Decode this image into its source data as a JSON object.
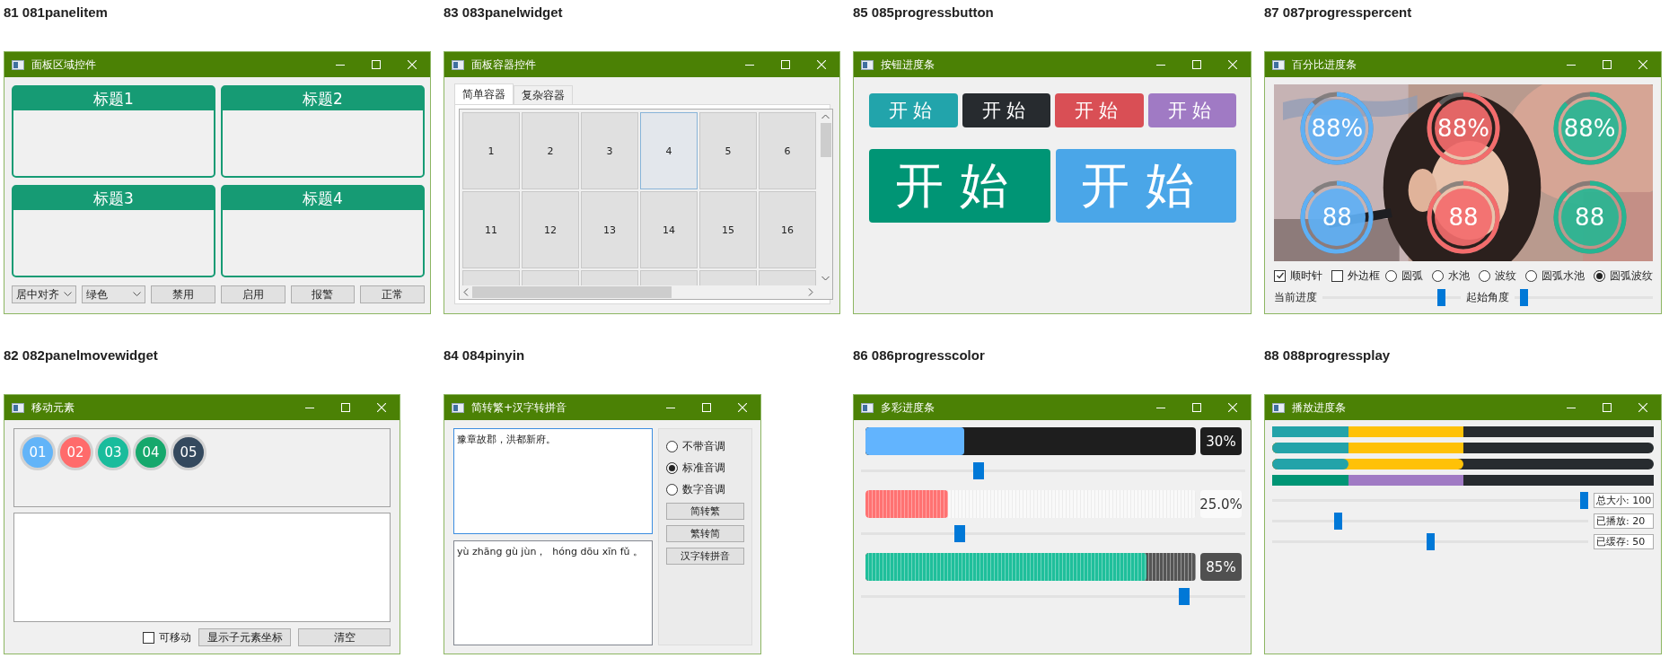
{
  "windows": [
    {
      "kind": "panelitem",
      "caption": "81 081panelitem",
      "title": "面板区域控件",
      "panels": [
        {
          "title": "标题1"
        },
        {
          "title": "标题2"
        },
        {
          "title": "标题3"
        },
        {
          "title": "标题4"
        }
      ],
      "combos": [
        {
          "value": "居中对齐"
        },
        {
          "value": "绿色"
        }
      ],
      "buttons": [
        "禁用",
        "启用",
        "报警",
        "正常"
      ]
    },
    {
      "kind": "panelwidget",
      "caption": "83 083panelwidget",
      "title": "面板容器控件",
      "tabs": [
        {
          "label": "简单容器",
          "selected": true
        },
        {
          "label": "复杂容器",
          "selected": false
        }
      ],
      "cells": [
        {
          "label": "1",
          "selected": false
        },
        {
          "label": "2",
          "selected": false
        },
        {
          "label": "3",
          "selected": false
        },
        {
          "label": "4",
          "selected": true
        },
        {
          "label": "5",
          "selected": false
        },
        {
          "label": "6",
          "selected": false
        },
        {
          "label": "11",
          "selected": false
        },
        {
          "label": "12",
          "selected": false
        },
        {
          "label": "13",
          "selected": false
        },
        {
          "label": "14",
          "selected": false
        },
        {
          "label": "15",
          "selected": false
        },
        {
          "label": "16",
          "selected": false
        }
      ]
    },
    {
      "kind": "progressbutton",
      "caption": "85 085progressbutton",
      "title": "按钮进度条",
      "small_buttons": [
        {
          "label": "开始",
          "color": "#22a4ab"
        },
        {
          "label": "开始",
          "color": "#272b2f"
        },
        {
          "label": "开始",
          "color": "#d94f55"
        },
        {
          "label": "开始",
          "color": "#a07ac4"
        }
      ],
      "large_buttons": [
        {
          "label": "开始",
          "color": "#009575"
        },
        {
          "label": "开始",
          "color": "#4aa6e8"
        }
      ]
    },
    {
      "kind": "progresspercent",
      "caption": "87 087progresspercent",
      "title": "百分比进度条",
      "picture": {
        "kind": "picture"
      },
      "rings": [
        {
          "text": "88%",
          "color": "#5eb0f5",
          "level": 0.88
        },
        {
          "text": "88%",
          "color": "#f36c6c",
          "level": 0.88
        },
        {
          "text": "88%",
          "color": "#27b592",
          "level": 0.88
        },
        {
          "text": "88",
          "color": "#5eb0f5",
          "level": 0.88
        },
        {
          "text": "88",
          "color": "#f36c6c",
          "level": 0.88
        },
        {
          "text": "88",
          "color": "#27b592",
          "level": 0.88
        }
      ],
      "checkboxes": [
        {
          "label": "顺时针",
          "checked": true
        },
        {
          "label": "外边框",
          "checked": false
        }
      ],
      "styles": [
        {
          "label": "圆弧",
          "selected": false
        },
        {
          "label": "水池",
          "selected": false
        },
        {
          "label": "波纹",
          "selected": false
        },
        {
          "label": "圆弧水池",
          "selected": false
        },
        {
          "label": "圆弧波纹",
          "selected": true
        }
      ],
      "sliders": [
        {
          "label": "当前进度",
          "level": 0.88
        },
        {
          "label": "起始角度",
          "level": 0.04
        }
      ]
    },
    {
      "kind": "panelmove",
      "caption": "82 082panelmovewidget",
      "title": "移动元素",
      "circles": [
        {
          "label": "01",
          "color": "#62b4f8"
        },
        {
          "label": "02",
          "color": "#ff6b6b"
        },
        {
          "label": "03",
          "color": "#1abc9c"
        },
        {
          "label": "04",
          "color": "#16a86c"
        },
        {
          "label": "05",
          "color": "#34495e"
        }
      ],
      "movable": {
        "label": "可移动",
        "checked": false
      },
      "buttons": [
        "显示子元素坐标",
        "清空"
      ]
    },
    {
      "kind": "pinyin",
      "caption": "84 084pinyin",
      "title": "简转繁+汉字转拼音",
      "input": {
        "value": "豫章故郡，洪都新府。"
      },
      "output": {
        "value": "yù zhāng gù jùn，  hóng dōu xīn fǔ 。"
      },
      "tones": [
        {
          "label": "不带音调",
          "selected": false
        },
        {
          "label": "标准音调",
          "selected": true
        },
        {
          "label": "数字音调",
          "selected": false
        }
      ],
      "buttons": [
        "简转繁",
        "繁转简",
        "汉字转拼音"
      ]
    },
    {
      "kind": "progresscolor",
      "caption": "86 086progresscolor",
      "title": "多彩进度条",
      "bars": [
        {
          "kind": "solid",
          "color": "#62b4fe",
          "level": 0.3,
          "text": "30%"
        },
        {
          "kind": "striped-light",
          "color": "#ff7272",
          "level": 0.25,
          "text": "25.0%"
        },
        {
          "kind": "striped-dark",
          "color": "#1fbf9b",
          "level": 0.85,
          "text": "85%"
        }
      ]
    },
    {
      "kind": "progressplay",
      "caption": "88 088progressplay",
      "title": "播放进度条",
      "bars": [
        {
          "kind": "square",
          "played": {
            "color": "#23a3a9"
          },
          "buffered": {
            "color": "#ffc107"
          }
        },
        {
          "kind": "rounded-track",
          "played": {
            "color": "#23a3a9"
          },
          "buffered": {
            "color": "#ffc107"
          }
        },
        {
          "kind": "rounded",
          "played": {
            "color": "#23a3a9"
          },
          "buffered": {
            "color": "#ffc107"
          }
        },
        {
          "kind": "square",
          "played": {
            "color": "#009575"
          },
          "buffered": {
            "color": "#a07ac4"
          }
        }
      ],
      "sliders": [
        {
          "label": "总大小: 100",
          "level": 1
        },
        {
          "label": "已播放: 20",
          "level": 0.2
        },
        {
          "label": "已缓存: 50",
          "level": 0.5
        }
      ]
    }
  ]
}
